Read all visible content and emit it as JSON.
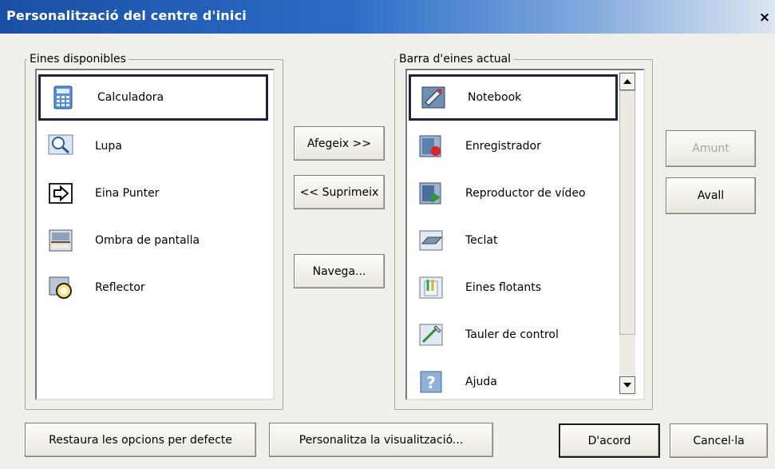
{
  "window": {
    "title": "Personalització del centre d'inici",
    "close_label": "×"
  },
  "available": {
    "legend": "Eines disponibles",
    "items": [
      {
        "label": "Calculadora",
        "icon": "calculator-icon"
      },
      {
        "label": "Lupa",
        "icon": "magnifier-icon"
      },
      {
        "label": "Eina Punter",
        "icon": "pointer-arrow-icon"
      },
      {
        "label": "Ombra de pantalla",
        "icon": "screen-shade-icon"
      },
      {
        "label": "Reflector",
        "icon": "spotlight-icon"
      }
    ],
    "selected_index": 0
  },
  "toolbar": {
    "legend": "Barra d'eines actual",
    "items": [
      {
        "label": "Notebook",
        "icon": "notebook-icon"
      },
      {
        "label": "Enregistrador",
        "icon": "recorder-icon"
      },
      {
        "label": "Reproductor de vídeo",
        "icon": "video-player-icon"
      },
      {
        "label": "Teclat",
        "icon": "keyboard-icon"
      },
      {
        "label": "Eines flotants",
        "icon": "floating-tools-icon"
      },
      {
        "label": "Tauler de control",
        "icon": "control-panel-icon"
      },
      {
        "label": "Ajuda",
        "icon": "help-icon"
      }
    ],
    "selected_index": 0
  },
  "buttons": {
    "add": "Afegeix >>",
    "remove": "<< Suprimeix",
    "browse": "Navega...",
    "up": "Amunt",
    "down": "Avall",
    "restore": "Restaura les opcions per defecte",
    "customize": "Personalitza la visualització...",
    "ok": "D'acord",
    "cancel": "Cancel·la"
  },
  "colors": {
    "title_gradient_start": "#1a4fa3",
    "title_gradient_end": "#dde6f1",
    "dialog_bg": "#f0efe9",
    "selection_border": "#1d2733",
    "disabled_text": "#a6a49c"
  }
}
